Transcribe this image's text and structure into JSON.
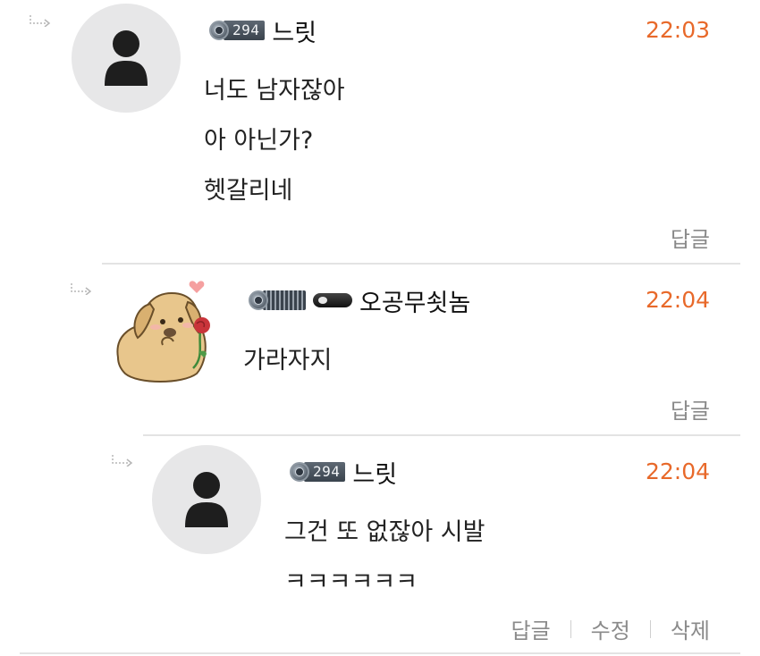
{
  "comments": [
    {
      "nickname": "느릿",
      "level": "294",
      "time": "22:03",
      "lines": [
        "너도 남자잖아",
        "아 아닌가?",
        "헷갈리네"
      ],
      "actions": [
        "답글"
      ]
    },
    {
      "nickname": "오공무쇳놈",
      "time": "22:04",
      "lines": [
        "가라자지"
      ],
      "actions": [
        "답글"
      ]
    },
    {
      "nickname": "느릿",
      "level": "294",
      "time": "22:04",
      "lines": [
        "그건 또 없잖아 시발",
        "ㅋㅋㅋㅋㅋㅋ"
      ],
      "actions": [
        "답글",
        "수정",
        "삭제"
      ]
    }
  ],
  "icons": {
    "reply": "reply-arrow-icon",
    "default_avatar": "person-silhouette-icon",
    "dog_avatar": "dog-with-rose-icon",
    "level": "level-emblem-icon",
    "item": "item-badge-icon"
  },
  "colors": {
    "time": "#e8692a",
    "action": "#8a8a8a",
    "avatar_bg": "#e7e7e8",
    "level_badge": "#4a545e"
  }
}
